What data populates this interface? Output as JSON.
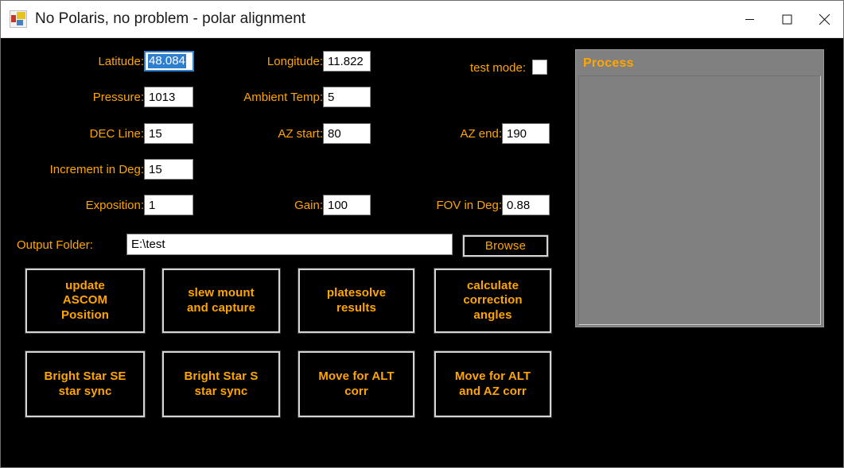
{
  "window": {
    "title": "No Polaris, no problem - polar alignment",
    "icon": "app-window-icon",
    "controls": {
      "minimize": "minimize-icon",
      "maximize": "maximize-icon",
      "close": "close-icon"
    }
  },
  "colors": {
    "label_orange": "#ffa500",
    "background": "#000000",
    "panel_gray": "#808080",
    "selection_blue": "#2f7fd1",
    "button_border": "#d4d4d4"
  },
  "form": {
    "fields": [
      {
        "label": "Latitude:",
        "value": "48.084",
        "selected": true
      },
      {
        "label": "Longitude:",
        "value": "11.822",
        "selected": false
      },
      {
        "label": "Pressure:",
        "value": "1013",
        "selected": false
      },
      {
        "label": "Ambient Temp:",
        "value": "5",
        "selected": false
      },
      {
        "label": "DEC Line:",
        "value": "15",
        "selected": false
      },
      {
        "label": "AZ start:",
        "value": "80",
        "selected": false
      },
      {
        "label": "AZ end:",
        "value": "190",
        "selected": false
      },
      {
        "label": "Increment in Deg:",
        "value": "15",
        "selected": false
      },
      {
        "label": "Exposition:",
        "value": "1",
        "selected": false
      },
      {
        "label": "Gain:",
        "value": "100",
        "selected": false
      },
      {
        "label": "FOV in Deg:",
        "value": "0.88",
        "selected": false
      }
    ],
    "test_mode": {
      "label": "test mode:",
      "checked": false
    },
    "output_folder": {
      "label": "Output Folder:",
      "value": "E:\\test",
      "browse_label": "Browse"
    }
  },
  "actions": {
    "row1": [
      {
        "lines": [
          "update",
          "ASCOM",
          "Position"
        ]
      },
      {
        "lines": [
          "slew mount",
          "and capture"
        ]
      },
      {
        "lines": [
          "platesolve",
          "results"
        ]
      },
      {
        "lines": [
          "calculate",
          "correction",
          "angles"
        ]
      }
    ],
    "row2": [
      {
        "lines": [
          "Bright Star SE",
          "star sync"
        ]
      },
      {
        "lines": [
          "Bright Star S",
          "star sync"
        ]
      },
      {
        "lines": [
          "Move for ALT",
          "corr"
        ]
      },
      {
        "lines": [
          "Move for ALT",
          "and AZ corr"
        ]
      }
    ]
  },
  "process": {
    "title": "Process",
    "items": []
  }
}
